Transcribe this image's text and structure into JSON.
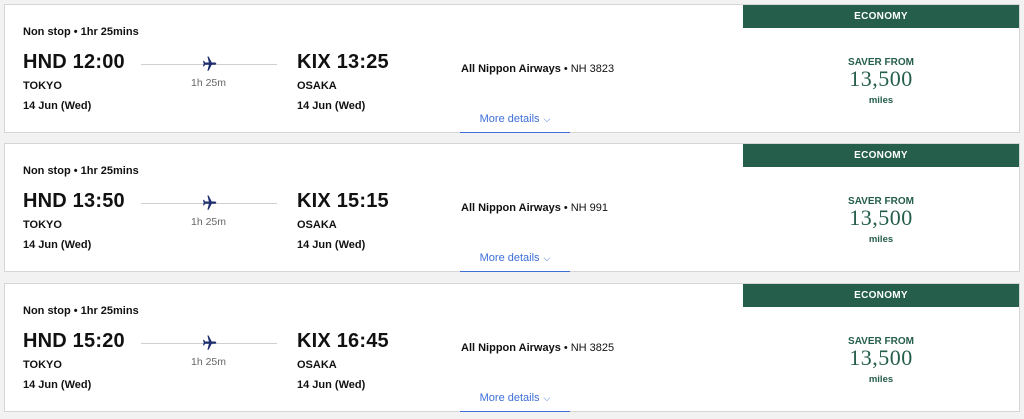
{
  "colors": {
    "accent": "#255e4a",
    "link": "#3d6fd8",
    "plane": "#1f2e6e"
  },
  "flights": [
    {
      "stops": "Non stop • 1hr 25mins",
      "dep_time": "HND 12:00",
      "dep_city": "TOKYO",
      "dep_date": "14 Jun (Wed)",
      "duration": "1h 25m",
      "arr_time": "KIX 13:25",
      "arr_city": "OSAKA",
      "arr_date": "14 Jun (Wed)",
      "airline": "All Nippon Airways",
      "flight_no": "NH 3823",
      "more_details": "More details",
      "cabin": "ECONOMY",
      "price_label": "SAVER FROM",
      "price": "13,500",
      "price_unit": "miles"
    },
    {
      "stops": "Non stop • 1hr 25mins",
      "dep_time": "HND 13:50",
      "dep_city": "TOKYO",
      "dep_date": "14 Jun (Wed)",
      "duration": "1h 25m",
      "arr_time": "KIX 15:15",
      "arr_city": "OSAKA",
      "arr_date": "14 Jun (Wed)",
      "airline": "All Nippon Airways",
      "flight_no": "NH 991",
      "more_details": "More details",
      "cabin": "ECONOMY",
      "price_label": "SAVER FROM",
      "price": "13,500",
      "price_unit": "miles"
    },
    {
      "stops": "Non stop • 1hr 25mins",
      "dep_time": "HND 15:20",
      "dep_city": "TOKYO",
      "dep_date": "14 Jun (Wed)",
      "duration": "1h 25m",
      "arr_time": "KIX 16:45",
      "arr_city": "OSAKA",
      "arr_date": "14 Jun (Wed)",
      "airline": "All Nippon Airways",
      "flight_no": "NH 3825",
      "more_details": "More details",
      "cabin": "ECONOMY",
      "price_label": "SAVER FROM",
      "price": "13,500",
      "price_unit": "miles"
    }
  ]
}
